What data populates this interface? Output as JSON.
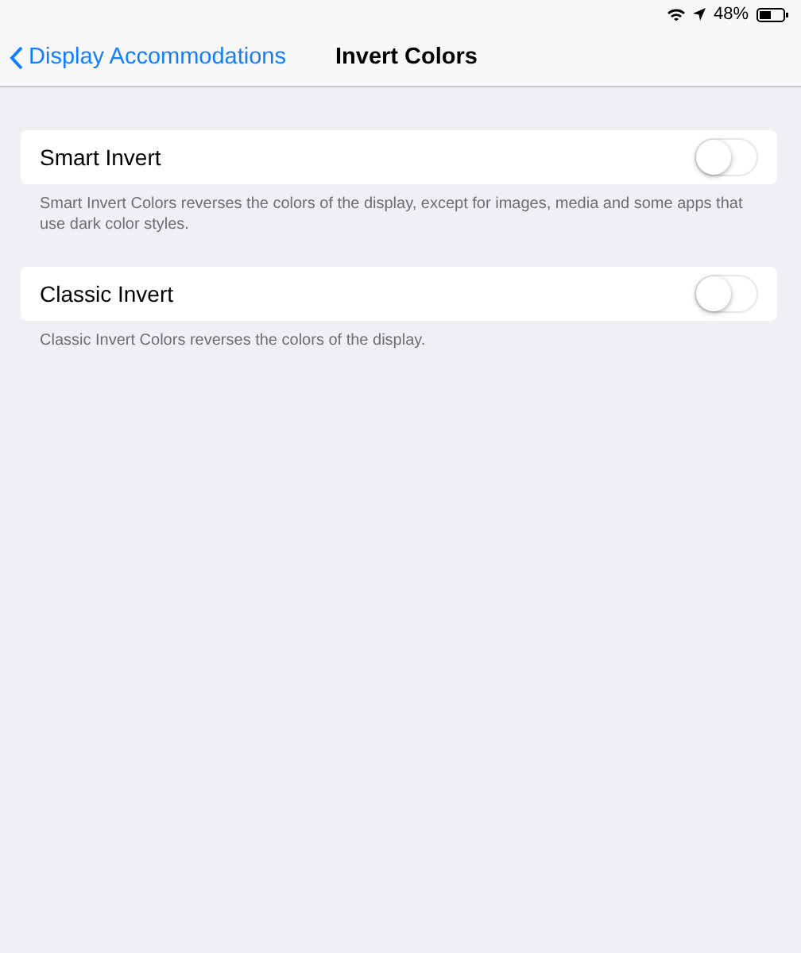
{
  "status_bar": {
    "battery": "48%"
  },
  "nav": {
    "back": "Display Accommodations",
    "title": "Invert Colors"
  },
  "settings": [
    {
      "label": "Smart Invert",
      "on": false,
      "footer": "Smart Invert Colors reverses the colors of the display, except for images, media and some apps that use dark color styles."
    },
    {
      "label": "Classic Invert",
      "on": false,
      "footer": "Classic Invert Colors reverses the colors of the display."
    }
  ]
}
